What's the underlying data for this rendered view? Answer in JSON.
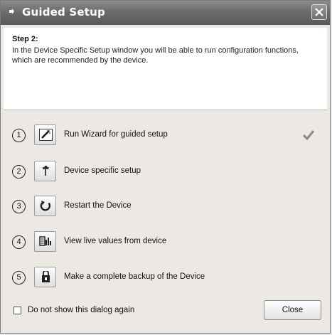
{
  "window": {
    "title": "Guided Setup",
    "title_icon": "gear-small-icon",
    "close_icon": "close-icon"
  },
  "info": {
    "step_title": "Step 2:",
    "step_description": "In the Device Specific Setup window you will be able to run configuration functions, which are recommended by the device."
  },
  "steps": [
    {
      "number": "1",
      "icon": "wizard-icon",
      "label": "Run Wizard for guided setup",
      "done": true
    },
    {
      "number": "2",
      "icon": "device-setup-icon",
      "label": "Device specific setup",
      "done": false
    },
    {
      "number": "3",
      "icon": "restart-icon",
      "label": "Restart the Device",
      "done": false
    },
    {
      "number": "4",
      "icon": "live-values-icon",
      "label": "View live values from device",
      "done": false
    },
    {
      "number": "5",
      "icon": "backup-icon",
      "label": "Make a complete backup of the Device",
      "done": false
    }
  ],
  "footer": {
    "dont_show_label": "Do not show this dialog again",
    "dont_show_checked": false,
    "close_label": "Close"
  },
  "colors": {
    "titlebar": "#6b6b6b",
    "check_mark": "#8a8a8a"
  }
}
